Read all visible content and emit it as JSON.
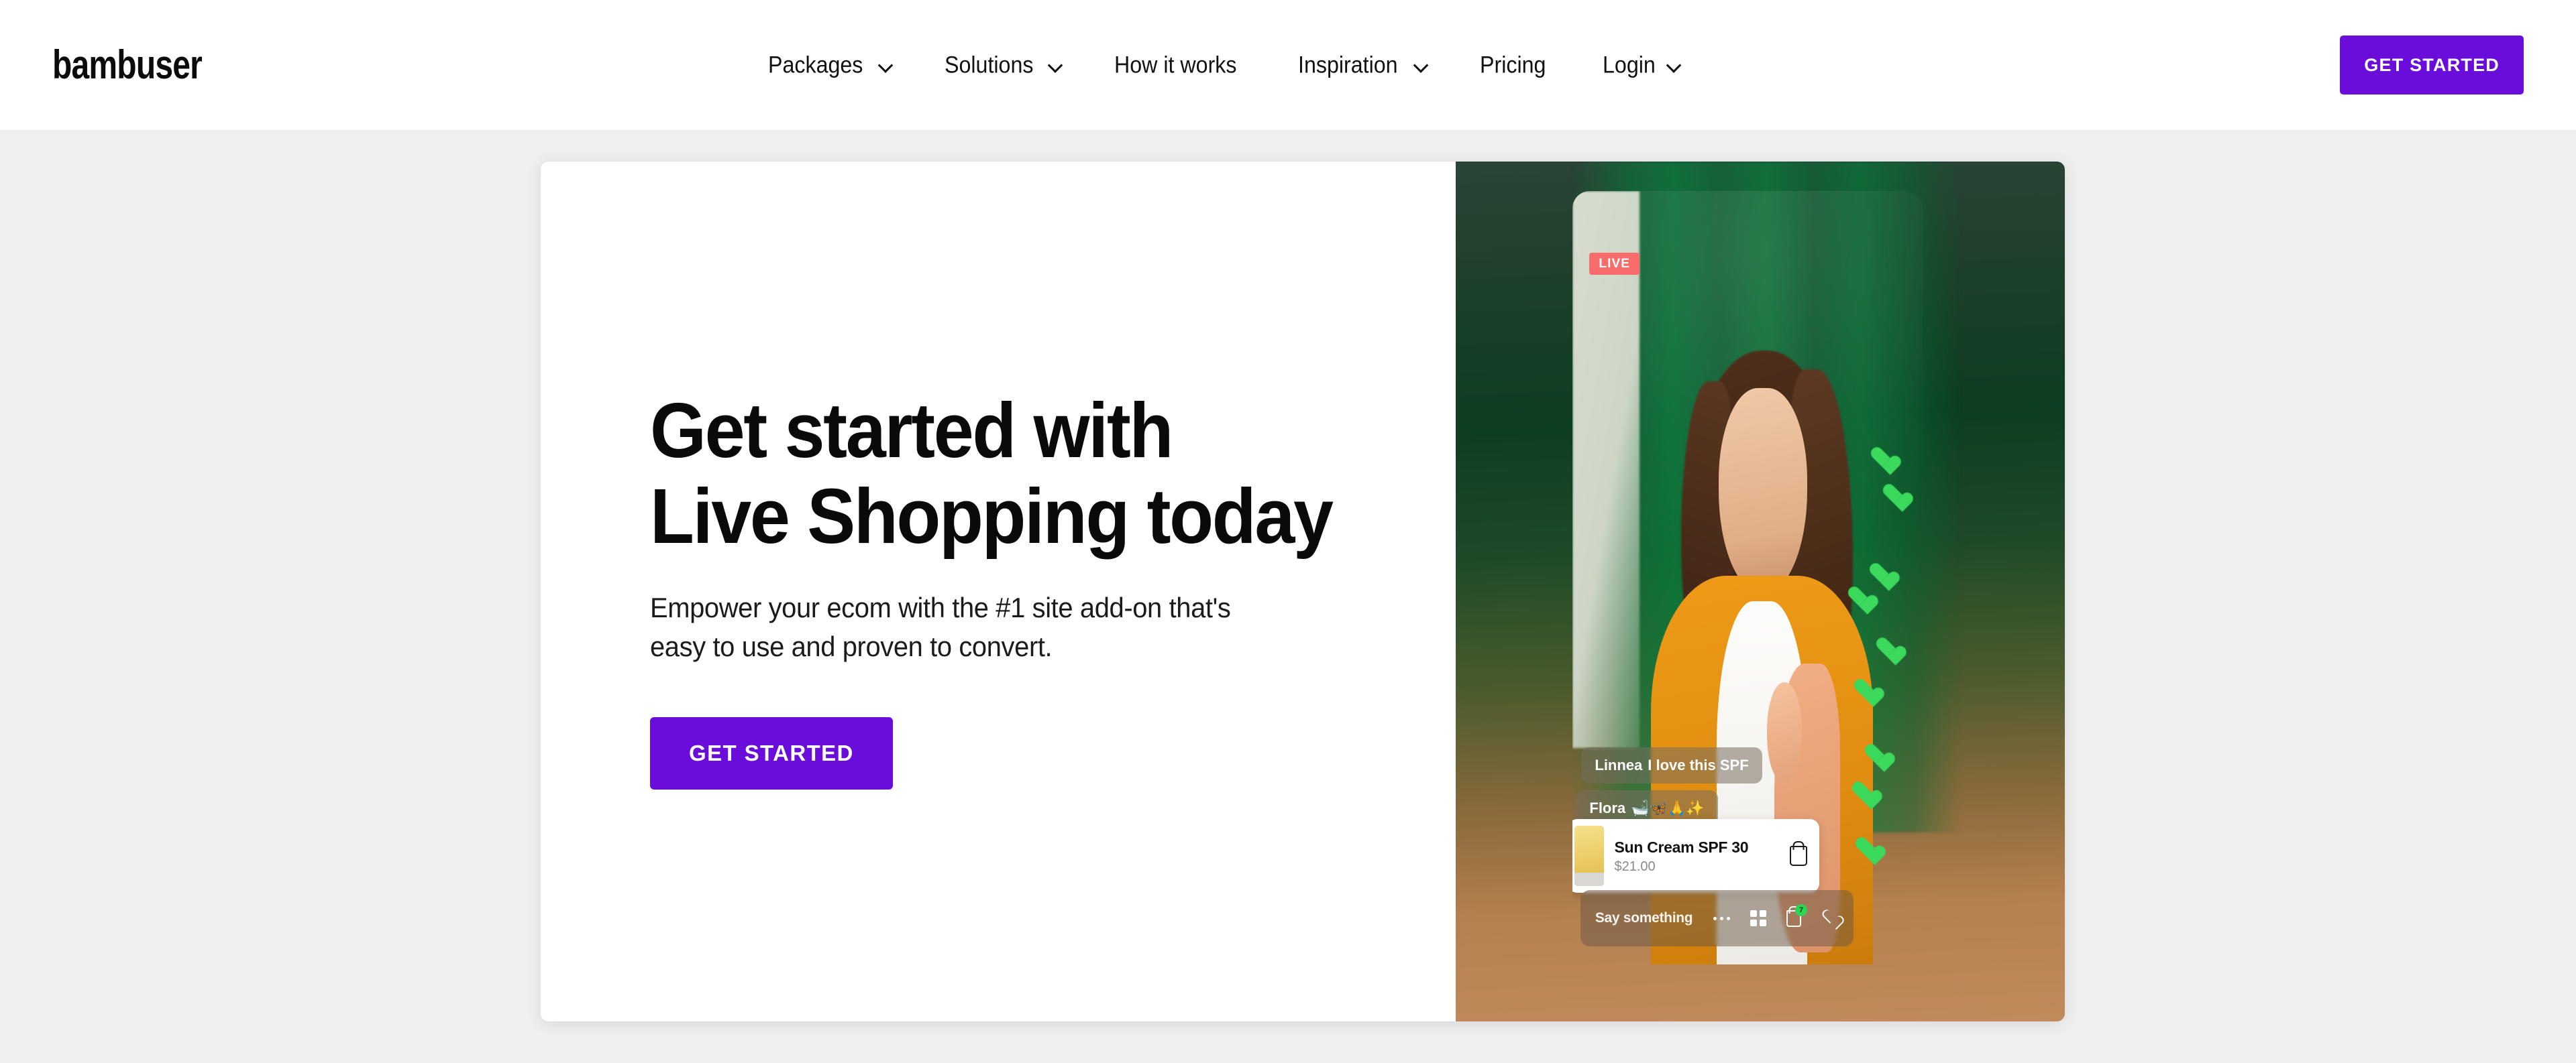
{
  "header": {
    "logo_text": "bambuser",
    "nav": [
      {
        "label": "Packages",
        "has_dropdown": true
      },
      {
        "label": "Solutions",
        "has_dropdown": true
      },
      {
        "label": "How it works",
        "has_dropdown": false
      },
      {
        "label": "Inspiration",
        "has_dropdown": true
      },
      {
        "label": "Pricing",
        "has_dropdown": false
      },
      {
        "label": "Login",
        "has_dropdown": true
      }
    ],
    "cta_label": "GET STARTED"
  },
  "hero": {
    "headline": "Get started with\nLive Shopping today",
    "subhead": "Empower your ecom with the #1 site add-on that's\neasy to use and proven to convert.",
    "cta_label": "GET STARTED"
  },
  "video": {
    "live_badge": "LIVE",
    "chat": [
      {
        "who": "Linnea",
        "text": "I love this SPF"
      },
      {
        "who": "Flora",
        "text": "🛁🦋🙏✨"
      }
    ],
    "product": {
      "name": "Sun Cream SPF 30",
      "price": "$21.00"
    },
    "composer_placeholder": "Say something",
    "cart_badge": "7"
  },
  "colors": {
    "brand_purple": "#6a0ddb",
    "live_red": "#f96c6c",
    "heart_green": "#3bd95c",
    "page_bg": "#efefef"
  }
}
